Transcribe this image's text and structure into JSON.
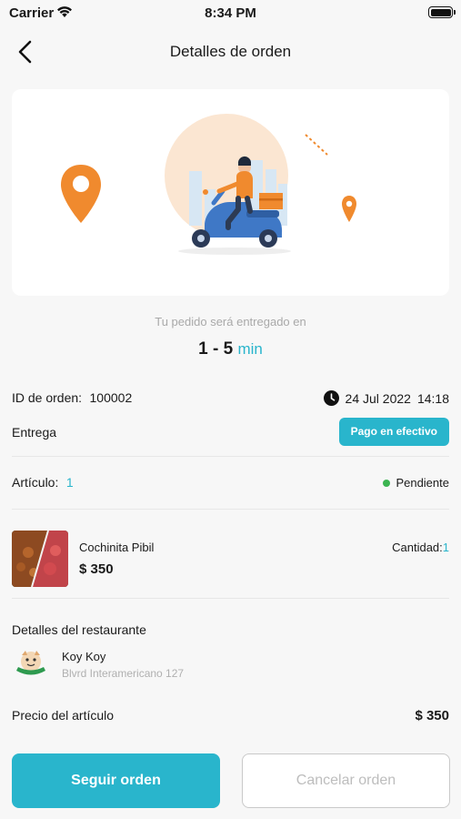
{
  "status_bar": {
    "carrier": "Carrier",
    "time": "8:34 PM"
  },
  "nav": {
    "back_icon": "chevron-left-icon",
    "title": "Detalles de orden"
  },
  "delivery": {
    "eta_label": "Tu pedido será entregado en",
    "eta_range": "1 - 5",
    "eta_unit": "min"
  },
  "order": {
    "id_label": "ID de orden:",
    "id_value": "100002",
    "date": "24 Jul 2022",
    "time": "14:18",
    "delivery_label": "Entrega",
    "payment_badge": "Pago en efectivo",
    "article_label": "Artículo:",
    "article_count": "1",
    "status": "Pendiente",
    "status_color": "#3cb451"
  },
  "item": {
    "name": "Cochinita Pibil",
    "price": "$ 350",
    "qty_label": "Cantidad:",
    "qty_value": "1"
  },
  "restaurant": {
    "section_title": "Detalles del restaurante",
    "name": "Koy Koy",
    "address": "Blvrd Interamericano 127"
  },
  "pricing": {
    "item_price_label": "Precio del artículo",
    "item_price_value": "$ 350"
  },
  "actions": {
    "track_label": "Seguir orden",
    "cancel_label": "Cancelar orden"
  },
  "colors": {
    "accent": "#29b5cc",
    "illustration_orange": "#f08a2e"
  }
}
